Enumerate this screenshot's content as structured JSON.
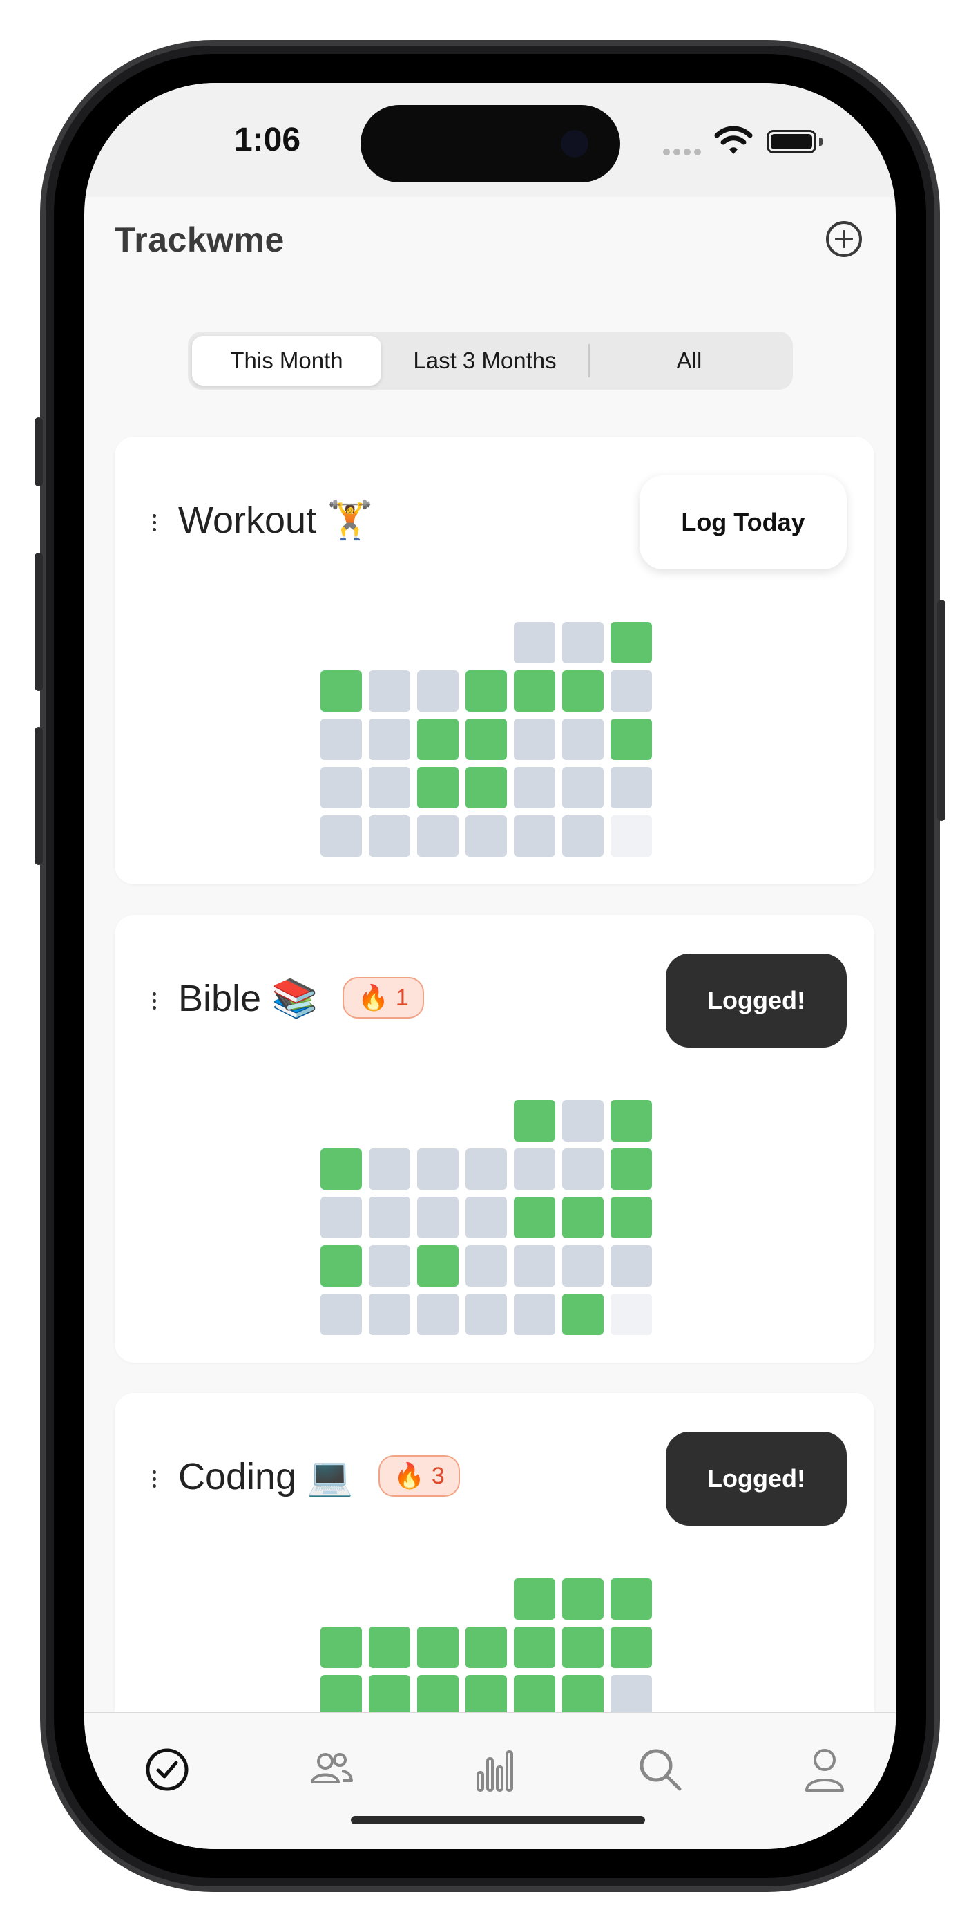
{
  "status_bar": {
    "time": "1:06"
  },
  "header": {
    "title": "Trackwme",
    "add_icon": "plus-circle-icon"
  },
  "segments": [
    {
      "label": "This Month",
      "selected": true
    },
    {
      "label": "Last 3 Months",
      "selected": false
    },
    {
      "label": "All",
      "selected": false
    }
  ],
  "cards": [
    {
      "name": "Workout",
      "emoji": "🏋️",
      "streak": null,
      "button_label": "Log Today",
      "logged": false,
      "grid": [
        [
          null,
          null,
          null,
          null,
          "e",
          "e",
          "g"
        ],
        [
          "g",
          "e",
          "e",
          "g",
          "g",
          "g",
          "e"
        ],
        [
          "e",
          "e",
          "g",
          "g",
          "e",
          "e",
          "g"
        ],
        [
          "e",
          "e",
          "g",
          "g",
          "e",
          "e",
          "e"
        ],
        [
          "e",
          "e",
          "e",
          "e",
          "e",
          "e",
          "f"
        ]
      ]
    },
    {
      "name": "Bible",
      "emoji": "📚",
      "streak": "1",
      "button_label": "Logged!",
      "logged": true,
      "grid": [
        [
          null,
          null,
          null,
          null,
          "g",
          "e",
          "g"
        ],
        [
          "g",
          "e",
          "e",
          "e",
          "e",
          "e",
          "g"
        ],
        [
          "e",
          "e",
          "e",
          "e",
          "g",
          "g",
          "g"
        ],
        [
          "g",
          "e",
          "g",
          "e",
          "e",
          "e",
          "e"
        ],
        [
          "e",
          "e",
          "e",
          "e",
          "e",
          "g",
          "f"
        ]
      ]
    },
    {
      "name": "Coding",
      "emoji": "💻",
      "streak": "3",
      "button_label": "Logged!",
      "logged": true,
      "grid": [
        [
          null,
          null,
          null,
          null,
          "g",
          "g",
          "g"
        ],
        [
          "g",
          "g",
          "g",
          "g",
          "g",
          "g",
          "g"
        ],
        [
          "g",
          "g",
          "g",
          "g",
          "g",
          "g",
          "e"
        ]
      ]
    }
  ],
  "colors": {
    "logged": "#5fc46b",
    "empty": "#d2d8e2",
    "future": "#f1f2f5",
    "streak_bg": "#fde3da",
    "streak_text": "#e0492b",
    "dark_button": "#2f2f2f"
  },
  "tabs": [
    {
      "icon": "checkmark-circle-icon",
      "active": true
    },
    {
      "icon": "people-icon",
      "active": false
    },
    {
      "icon": "bar-chart-icon",
      "active": false
    },
    {
      "icon": "search-icon",
      "active": false
    },
    {
      "icon": "profile-icon",
      "active": false
    }
  ]
}
